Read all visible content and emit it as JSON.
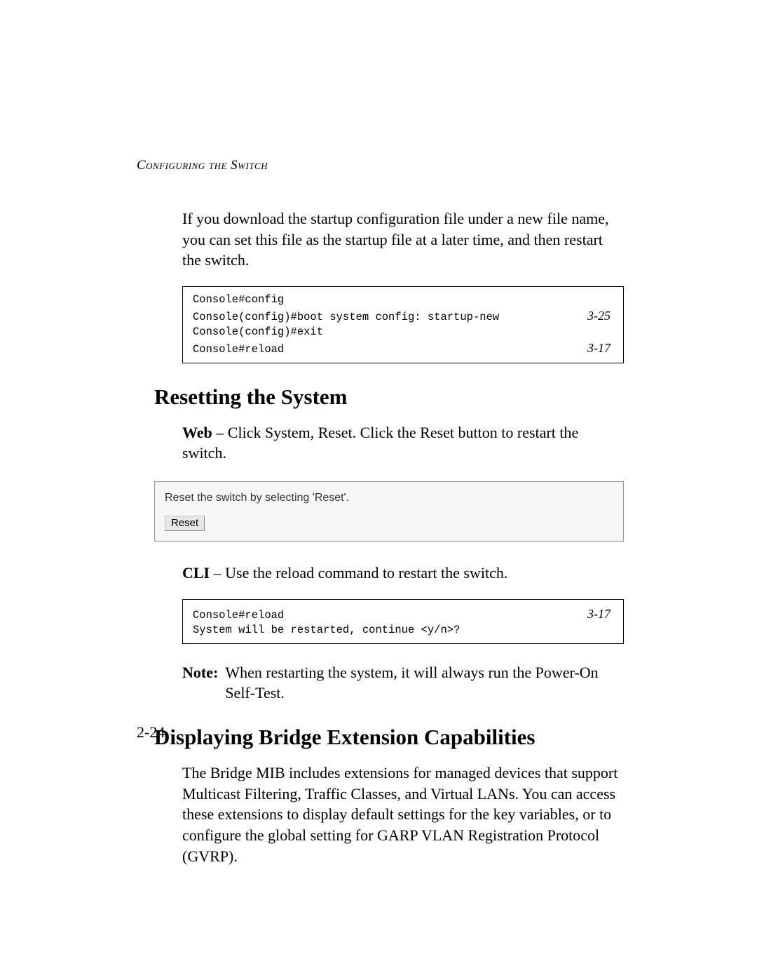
{
  "header": "Configuring the Switch",
  "intro": "If you download the startup configuration file under a new file name, you can set this file as the startup file at a later time, and then restart the switch.",
  "code1": {
    "lines": [
      {
        "cmd": "Console#config",
        "ref": ""
      },
      {
        "cmd": "Console(config)#boot system config: startup-new",
        "ref": "3-25"
      },
      {
        "cmd": "Console(config)#exit",
        "ref": ""
      },
      {
        "cmd": "Console#reload",
        "ref": "3-17"
      }
    ]
  },
  "section1": {
    "title": "Resetting the System",
    "web_label": "Web",
    "web_text": " – Click System, Reset. Click the Reset button to restart the switch.",
    "panel_text": "Reset the switch by selecting 'Reset'.",
    "reset_button": "Reset",
    "cli_label": "CLI",
    "cli_text": " – Use the reload command to restart the switch.",
    "note_label": "Note:",
    "note_text": "When restarting the system, it will always run the Power-On Self-Test."
  },
  "code2": {
    "lines": [
      {
        "cmd": "Console#reload",
        "ref": "3-17"
      },
      {
        "cmd": "System will be restarted, continue <y/n>?",
        "ref": ""
      }
    ]
  },
  "section2": {
    "title": "Displaying Bridge Extension Capabilities",
    "body": "The Bridge MIB includes extensions for managed devices that support Multicast Filtering, Traffic Classes, and Virtual LANs. You can access these extensions to display default settings for the key variables, or to configure the global setting for GARP VLAN Registration Protocol (GVRP)."
  },
  "page_number": "2-24"
}
